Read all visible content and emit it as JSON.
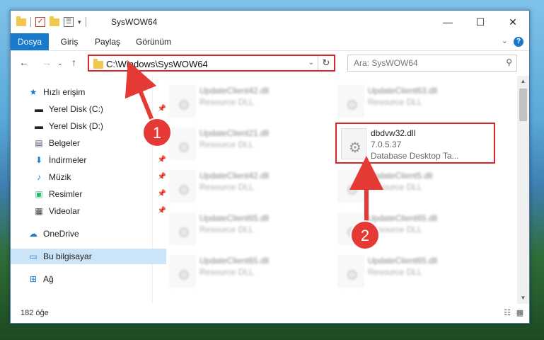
{
  "window": {
    "title": "SysWOW64"
  },
  "ribbon": {
    "tabs": [
      "Dosya",
      "Giriş",
      "Paylaş",
      "Görünüm"
    ]
  },
  "address": {
    "path": "C:\\Windows\\SysWOW64"
  },
  "search": {
    "placeholder": "Ara: SysWOW64"
  },
  "sidebar": {
    "items": [
      {
        "label": "Hızlı erişim",
        "icon": "star-icon"
      },
      {
        "label": "Yerel Disk (C:)",
        "icon": "drive-icon",
        "pinned": true
      },
      {
        "label": "Yerel Disk (D:)",
        "icon": "drive-icon",
        "pinned": true
      },
      {
        "label": "Belgeler",
        "icon": "documents-icon",
        "pinned": true
      },
      {
        "label": "İndirmeler",
        "icon": "download-icon",
        "pinned": true
      },
      {
        "label": "Müzik",
        "icon": "music-icon",
        "pinned": true
      },
      {
        "label": "Resimler",
        "icon": "pictures-icon",
        "pinned": true
      },
      {
        "label": "Videolar",
        "icon": "videos-icon",
        "pinned": true
      },
      {
        "label": "OneDrive",
        "icon": "cloud-icon"
      },
      {
        "label": "Bu bilgisayar",
        "icon": "computer-icon"
      },
      {
        "label": "Ağ",
        "icon": "network-icon"
      }
    ]
  },
  "files": [
    {
      "name": "UpdateClient42.dll",
      "line2": "Resource DLL",
      "line3": ""
    },
    {
      "name": "UpdateClient63.dll",
      "line2": "Resource DLL",
      "line3": ""
    },
    {
      "name": "UpdateClient21.dll",
      "line2": "Resource DLL",
      "line3": ""
    },
    {
      "name": "dbdvw32.dll",
      "line2": "7.0.5.37",
      "line3": "Database Desktop Ta..."
    },
    {
      "name": "UpdateClient42.dll",
      "line2": "Resource DLL",
      "line3": ""
    },
    {
      "name": "UpdateClient5.dll",
      "line2": "Resource DLL",
      "line3": ""
    },
    {
      "name": "UpdateClient65.dll",
      "line2": "Resource DLL",
      "line3": ""
    },
    {
      "name": "UpdateClient65.dll",
      "line2": "Resource DLL",
      "line3": ""
    },
    {
      "name": "UpdateClient65.dll",
      "line2": "Resource DLL",
      "line3": ""
    },
    {
      "name": "UpdateClient65.dll",
      "line2": "Resource DLL",
      "line3": ""
    }
  ],
  "status": {
    "count": "182 öğe"
  },
  "annotations": {
    "step1": "1",
    "step2": "2"
  },
  "colors": {
    "accent": "#1979ca",
    "highlight": "#d9262c",
    "selected": "#cce4f7"
  }
}
